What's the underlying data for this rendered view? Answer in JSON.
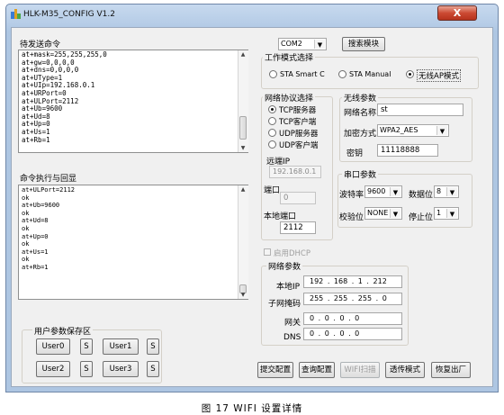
{
  "window": {
    "title": "HLK-M35_CONFIG V1.2",
    "close_label": "X"
  },
  "left": {
    "send_cmds_label": "待发送命令",
    "send_cmds_text": "at+mask=255,255,255,0\nat+gw=0,0,0,0\nat+dns=0,0,0,0\nat+UType=1\nat+UIp=192.168.0.1\nat+URPort=0\nat+ULPort=2112\nat+Ub=9600\nat+Ud=8\nat+Up=0\nat+Us=1\nat+Rb=1",
    "result_label": "命令执行与回显",
    "result_text": "at+ULPort=2112\nok\nat+Ub=9600\nok\nat+Ud=8\nok\nat+Up=0\nok\nat+Us=1\nok\nat+Rb=1",
    "user_params_label": "用户参数保存区",
    "user_buttons": [
      "User0",
      "S",
      "User1",
      "S",
      "User2",
      "S",
      "User3",
      "S"
    ]
  },
  "top": {
    "com_port": "COM2",
    "search_button": "搜索模块",
    "mode_group_label": "工作模式选择",
    "modes": [
      "STA Smart C",
      "STA Manual",
      "无线AP模式"
    ]
  },
  "protocol": {
    "group_label": "网络协议选择",
    "options": [
      "TCP服务器",
      "TCP客户端",
      "UDP服务器",
      "UDP客户端"
    ],
    "remote_ip_label": "远端IP",
    "remote_ip": "192.168.0.1",
    "port_label": "端口",
    "port_value": "0",
    "local_port_label": "本地端口",
    "local_port_value": "2112"
  },
  "wireless": {
    "group_label": "无线参数",
    "ssid_label": "网络名称",
    "ssid_value": "st",
    "encryption_label": "加密方式",
    "encryption_value": "WPA2_AES",
    "key_label": "密钥",
    "key_value": "11118888"
  },
  "serial": {
    "group_label": "串口参数",
    "baud_label": "波特率",
    "baud_value": "9600",
    "databits_label": "数据位",
    "databits_value": "8",
    "parity_label": "校验位",
    "parity_value": "NONE",
    "stopbits_label": "停止位",
    "stopbits_value": "1"
  },
  "network": {
    "dhcp_label": "启用DHCP",
    "group_label": "网络参数",
    "local_ip_label": "本地IP",
    "local_ip": "192 . 168 . 1 . 212",
    "mask_label": "子网掩码",
    "mask": "255 . 255 . 255 . 0",
    "gateway_label": "网关",
    "gateway": "0 . 0 . 0 . 0",
    "dns_label": "DNS",
    "dns": "0 . 0 . 0 . 0"
  },
  "bottom_buttons": {
    "submit": "提交配置",
    "query": "查询配置",
    "wifi_scan": "WIFI扫描",
    "transparent": "透传模式",
    "factory": "恢复出厂"
  },
  "caption": "图 17 WIFI 设置详情"
}
